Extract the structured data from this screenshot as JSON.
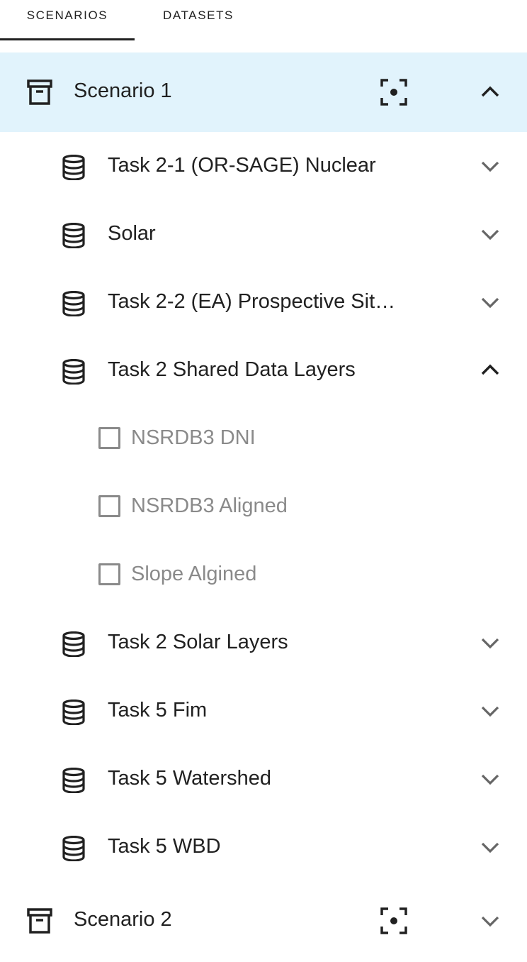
{
  "tabs": [
    {
      "label": "SCENARIOS",
      "active": true
    },
    {
      "label": "DATASETS",
      "active": false
    }
  ],
  "scenarios": [
    {
      "label": "Scenario 1",
      "expanded": true,
      "datasets": [
        {
          "label": "Task 2-1 (OR-SAGE) Nuclear",
          "expanded": false
        },
        {
          "label": "Solar",
          "expanded": false
        },
        {
          "label": "Task 2-2 (EA) Prospective Sit…",
          "expanded": false
        },
        {
          "label": "Task 2 Shared Data Layers",
          "expanded": true,
          "layers": [
            {
              "label": "NSRDB3 DNI",
              "checked": false
            },
            {
              "label": "NSRDB3 Aligned",
              "checked": false
            },
            {
              "label": "Slope Algined",
              "checked": false
            }
          ]
        },
        {
          "label": "Task 2 Solar Layers",
          "expanded": false
        },
        {
          "label": "Task 5 Fim",
          "expanded": false
        },
        {
          "label": "Task 5 Watershed",
          "expanded": false
        },
        {
          "label": "Task 5 WBD",
          "expanded": false
        }
      ]
    },
    {
      "label": "Scenario 2",
      "expanded": false
    }
  ],
  "colors": {
    "selected_row": "#e1f3fc",
    "text": "#212121",
    "muted": "#8a8a8a"
  },
  "icons": {
    "scenario": "archive-box-icon",
    "dataset": "database-icon",
    "focus": "focus-center-icon",
    "expanded": "chevron-up-icon",
    "collapsed": "chevron-down-icon"
  }
}
